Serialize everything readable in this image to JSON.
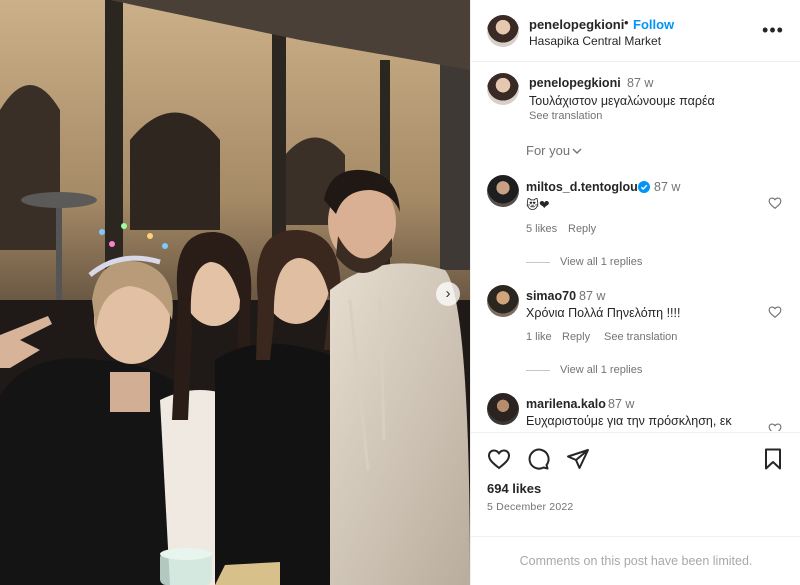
{
  "post": {
    "username": "penelopegkioni",
    "separator": "•",
    "follow_label": "Follow",
    "location": "Hasapika Central Market",
    "more_label": "•••"
  },
  "caption": {
    "username": "penelopegkioni",
    "time": "87 w",
    "text": "Τουλάχιστον μεγαλώνουμε παρέα",
    "translation_label": "See translation",
    "sort_label": "For you"
  },
  "comments": [
    {
      "username": "miltos_d.tentoglou",
      "verified": true,
      "time": "87 w",
      "text": "😻❤",
      "likes": "5 likes",
      "reply_label": "Reply",
      "view_replies": "View all 1 replies"
    },
    {
      "username": "simao70",
      "time": "87 w",
      "text": "Χρόνια Πολλά Πηνελόπη !!!!",
      "likes": "1 like",
      "reply_label": "Reply",
      "translation_label": "See translation",
      "view_replies": "View all 1 replies"
    },
    {
      "username": "marilena.kalo",
      "time": "87 w",
      "text": "Ευχαριστούμε για την πρόσκληση, εκ"
    }
  ],
  "footer": {
    "likes": "694 likes",
    "date": "5 December 2022",
    "comments_limited": "Comments on this post have been limited."
  },
  "icons": {
    "heart": "heart-icon",
    "comment": "comment-icon",
    "share": "share-icon",
    "bookmark": "bookmark-icon",
    "next": "chevron-right-icon",
    "more": "more-options-icon",
    "verified": "verified-badge-icon"
  },
  "colors": {
    "accent": "#0095f6",
    "text": "#262626",
    "muted": "#737373",
    "border": "#efefef"
  }
}
